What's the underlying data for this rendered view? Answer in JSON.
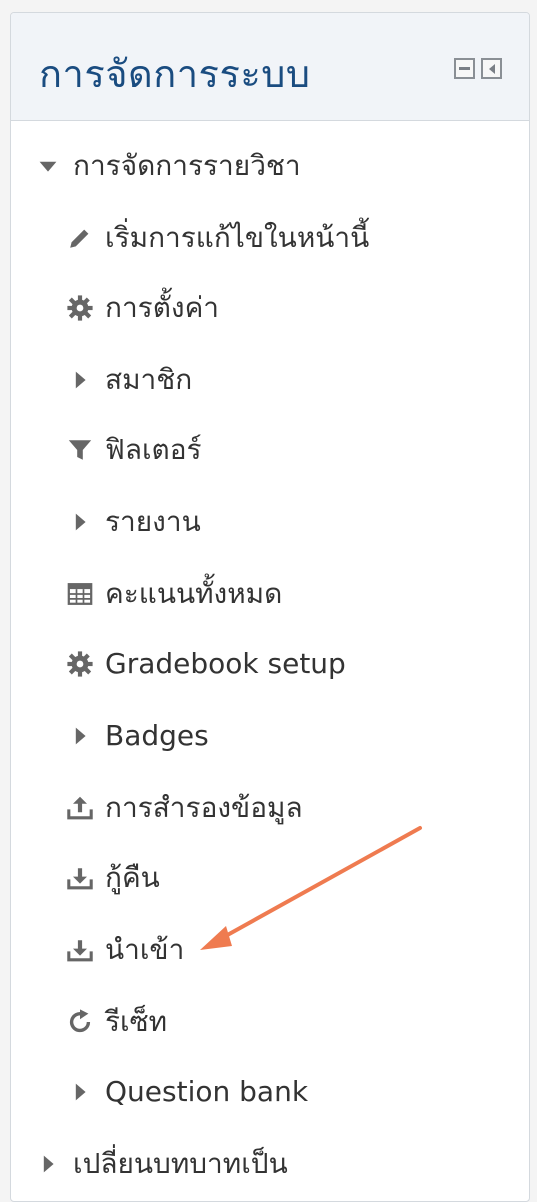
{
  "block": {
    "title": "การจัดการระบบ",
    "controls": [
      "hide-block",
      "dock-block"
    ]
  },
  "menu": {
    "items": [
      {
        "label": "การจัดการรายวิชา",
        "icon": "caret-down-icon",
        "level": 0
      },
      {
        "label": "เริ่มการแก้ไขในหน้านี้",
        "icon": "pencil-icon",
        "level": 1
      },
      {
        "label": "การตั้งค่า",
        "icon": "gear-icon",
        "level": 1
      },
      {
        "label": "สมาชิก",
        "icon": "caret-right-icon",
        "level": 1
      },
      {
        "label": "ฟิลเตอร์",
        "icon": "filter-icon",
        "level": 1
      },
      {
        "label": "รายงาน",
        "icon": "caret-right-icon",
        "level": 1
      },
      {
        "label": "คะแนนทั้งหมด",
        "icon": "table-icon",
        "level": 1
      },
      {
        "label": "Gradebook setup",
        "icon": "gear-icon",
        "level": 1
      },
      {
        "label": "Badges",
        "icon": "caret-right-icon",
        "level": 1
      },
      {
        "label": "การสำรองข้อมูล",
        "icon": "upload-icon",
        "level": 1
      },
      {
        "label": "กู้คืน",
        "icon": "download-icon",
        "level": 1
      },
      {
        "label": "นำเข้า",
        "icon": "download-icon",
        "level": 1
      },
      {
        "label": "รีเซ็ท",
        "icon": "refresh-icon",
        "level": 1
      },
      {
        "label": "Question bank",
        "icon": "caret-right-icon",
        "level": 1
      },
      {
        "label": "เปลี่ยนบทบาทเป็น",
        "icon": "caret-right-icon",
        "level": 0
      }
    ]
  },
  "annotation": {
    "icon": "arrow-icon",
    "color": "#ef7b50",
    "points_to": "นำเข้า"
  },
  "colors": {
    "title": "#1a4c80",
    "text": "#333333",
    "icon": "#666666",
    "header_bg": "#f1f4f8"
  }
}
